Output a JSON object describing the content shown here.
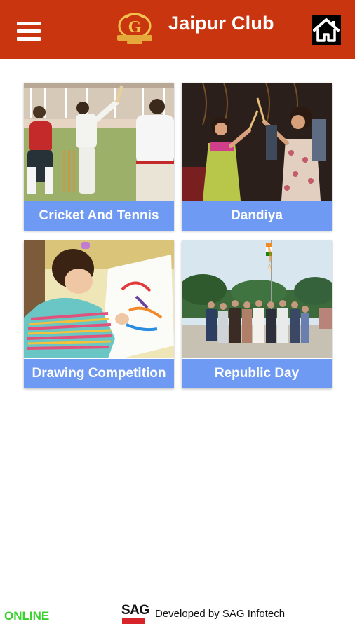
{
  "header": {
    "title": "Jaipur Club",
    "background_color": "#c9350f",
    "menu_icon": "hamburger-menu-icon",
    "home_icon": "home-icon",
    "logo_icon": "jaipur-club-logo"
  },
  "tiles": [
    {
      "label": "Cricket And Tennis",
      "image": "cricket-match-photo"
    },
    {
      "label": "Dandiya",
      "image": "dandiya-dance-photo"
    },
    {
      "label": "Drawing Competition",
      "image": "child-drawing-photo"
    },
    {
      "label": "Republic Day",
      "image": "republic-day-flag-photo"
    }
  ],
  "tile_caption_color": "#6f9af4",
  "footer": {
    "status": "ONLINE",
    "status_color": "#37d32a",
    "brand": "SAG",
    "credit": "Developed by SAG Infotech"
  }
}
